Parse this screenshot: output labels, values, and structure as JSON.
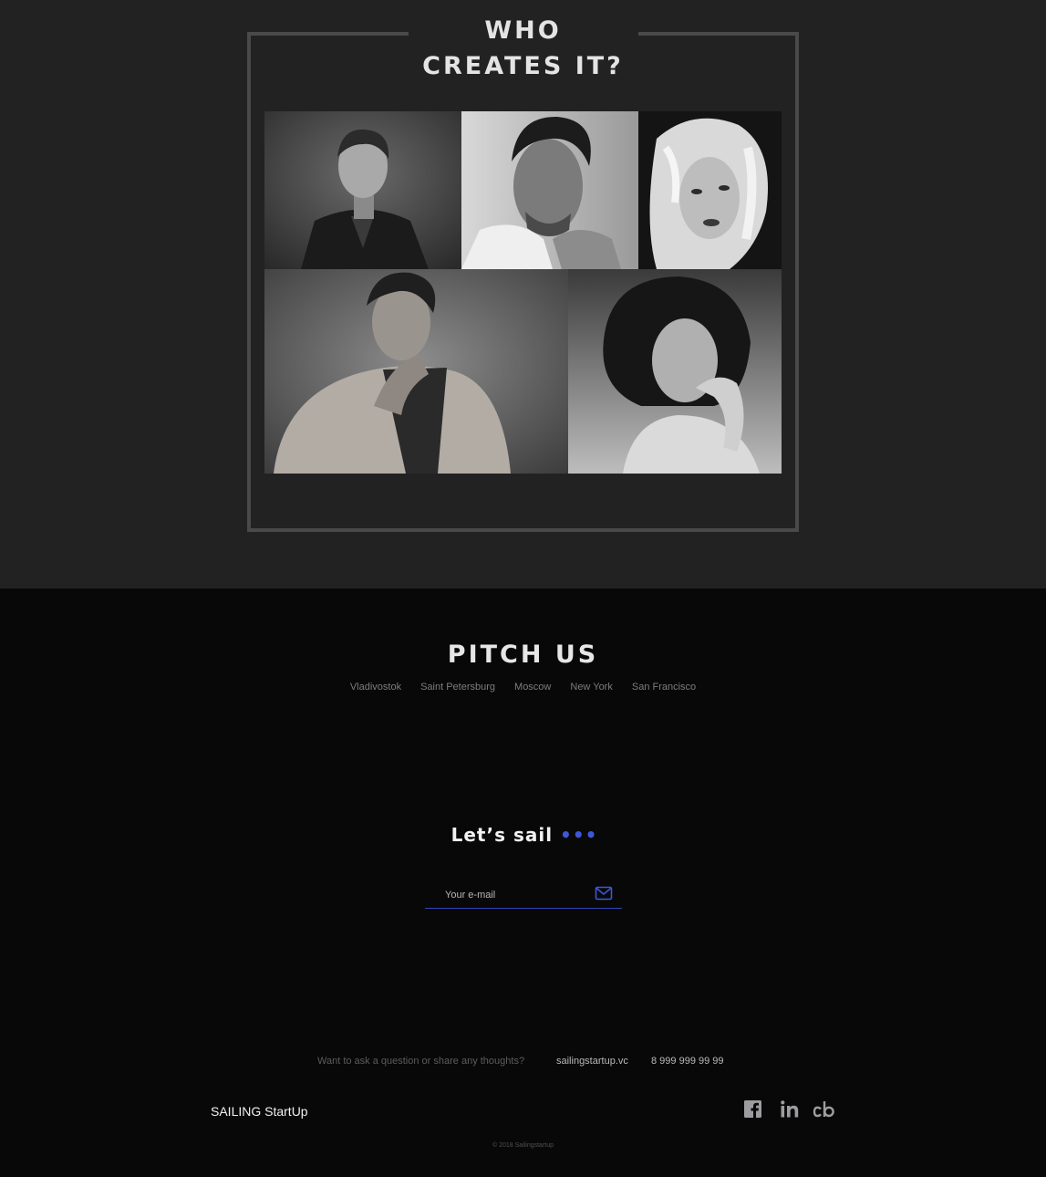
{
  "team": {
    "title_line1": "WHO",
    "title_line2": "CREATES IT?",
    "photos": [
      "team-member-1-portrait",
      "team-member-2-portrait",
      "team-member-3-portrait",
      "team-member-4-portrait",
      "team-member-5-portrait"
    ]
  },
  "pitch": {
    "title": "PITCH US",
    "cities": [
      "Vladivostok",
      "Saint Petersburg",
      "Moscow",
      "New York",
      "San Francisco"
    ]
  },
  "signup": {
    "heading": "Let’s sail",
    "dots": "•••",
    "email_placeholder": "Your e-mail",
    "submit_icon": "envelope-icon",
    "accent_color": "#3d57d8"
  },
  "footer": {
    "question": "Want to ask a question or share any thoughts?",
    "site": "sailingstartup.vc",
    "phone": "8 999 999 99 99",
    "brand": "SAILING StartUp",
    "social_icons": [
      "facebook-icon",
      "linkedin-icon",
      "crunchbase-icon"
    ],
    "copyright": "© 2018 Sailingstartup"
  }
}
